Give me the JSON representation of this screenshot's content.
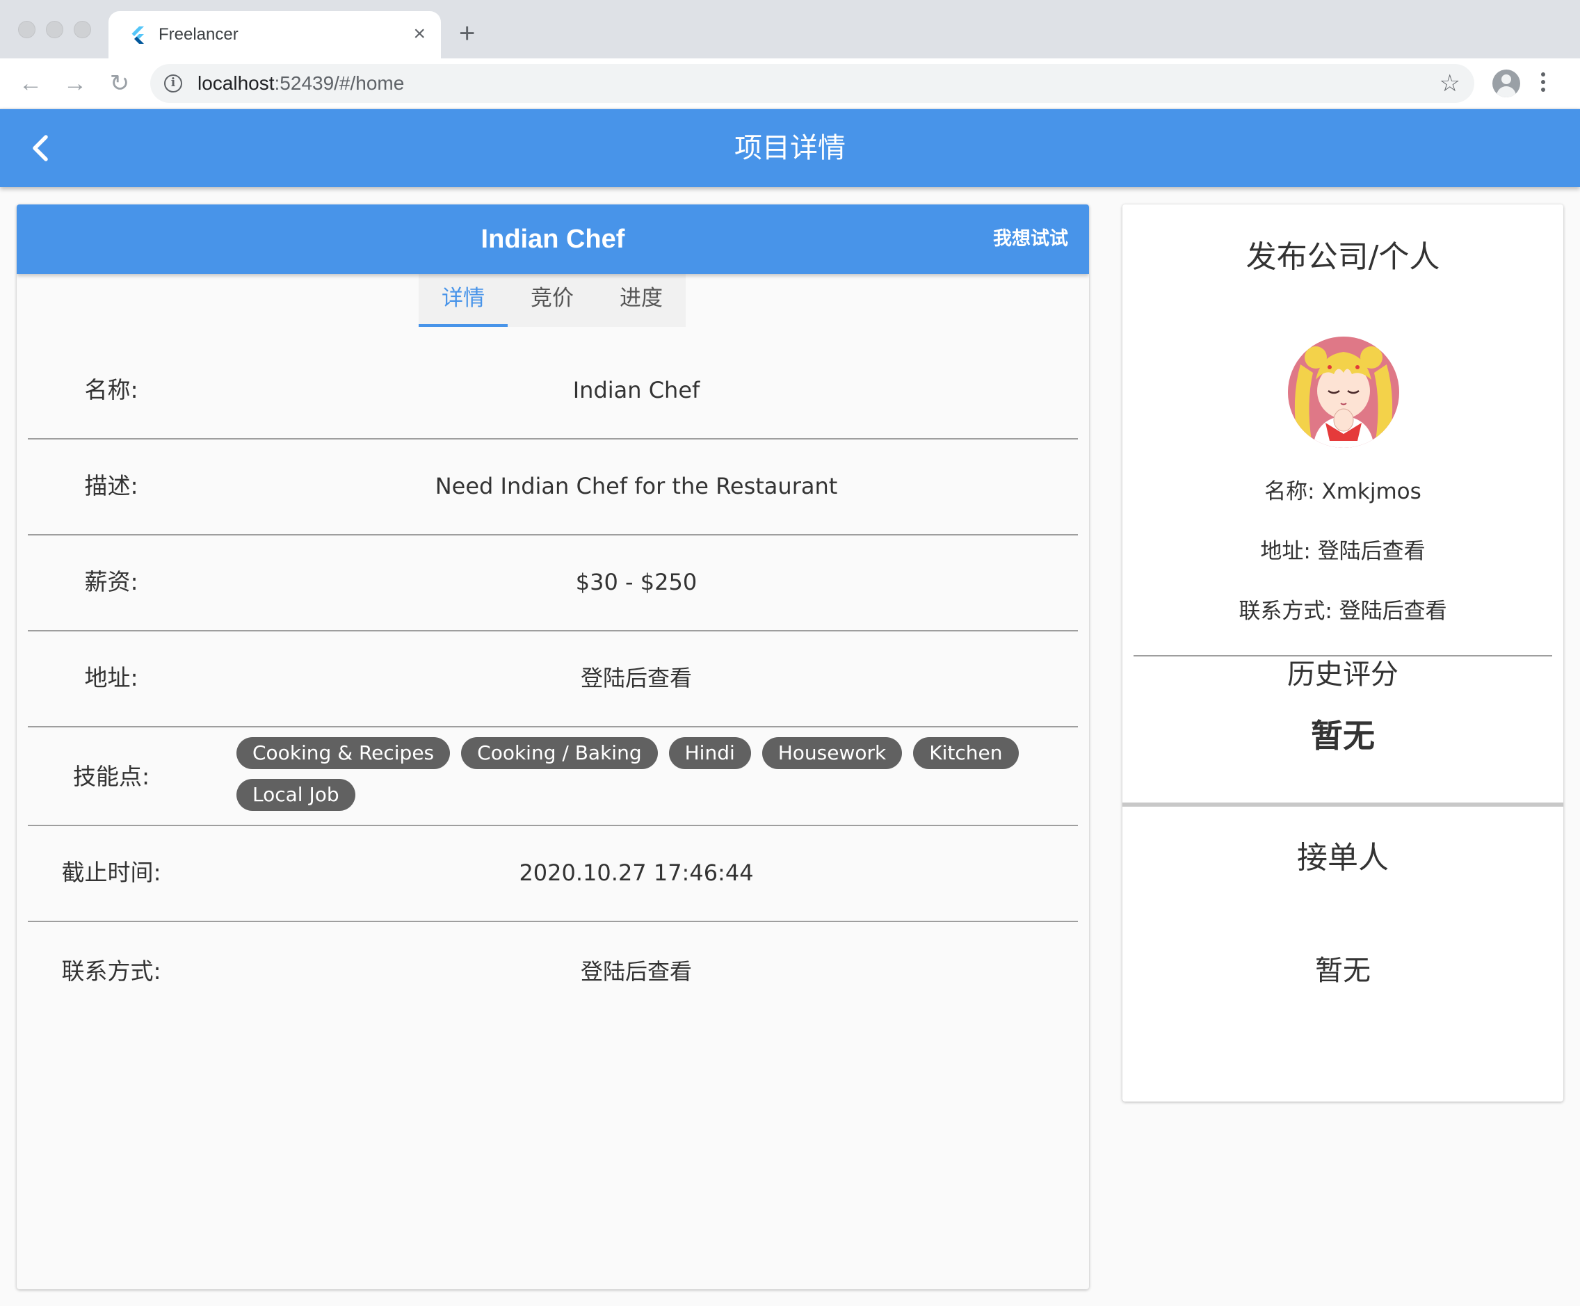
{
  "browser": {
    "tab_title": "Freelancer",
    "url_host": "localhost",
    "url_rest": ":52439/#/home",
    "tab_close": "×",
    "new_tab": "+",
    "back": "←",
    "forward": "→",
    "reload": "↻",
    "star": "☆",
    "info": "i"
  },
  "appbar": {
    "title": "项目详情"
  },
  "project": {
    "header_title": "Indian Chef",
    "try_button": "我想试试",
    "tabs": [
      {
        "label": "详情",
        "active": true
      },
      {
        "label": "竞价",
        "active": false
      },
      {
        "label": "进度",
        "active": false
      }
    ],
    "rows": {
      "name": {
        "label": "名称:",
        "value": "Indian Chef"
      },
      "description": {
        "label": "描述:",
        "value": "Need Indian Chef for the Restaurant"
      },
      "salary": {
        "label": "薪资:",
        "value": "$30 - $250"
      },
      "address": {
        "label": "地址:",
        "value": "登陆后查看"
      },
      "skills": {
        "label": "技能点:",
        "chips": [
          "Cooking & Recipes",
          "Cooking / Baking",
          "Hindi",
          "Housework",
          "Kitchen",
          "Local Job"
        ]
      },
      "deadline": {
        "label": "截止时间:",
        "value": "2020.10.27 17:46:44"
      },
      "contact": {
        "label": "联系方式:",
        "value": "登陆后查看"
      }
    }
  },
  "publisher": {
    "title": "发布公司/个人",
    "name": "名称:  Xmkjmos",
    "address": "地址:  登陆后查看",
    "contact": "联系方式:  登陆后查看",
    "rating_title": "历史评分",
    "rating_value": "暂无",
    "taker_title": "接单人",
    "taker_value": "暂无"
  },
  "colors": {
    "primary": "#4894e9",
    "chip": "#616161",
    "background": "#fafafa"
  }
}
